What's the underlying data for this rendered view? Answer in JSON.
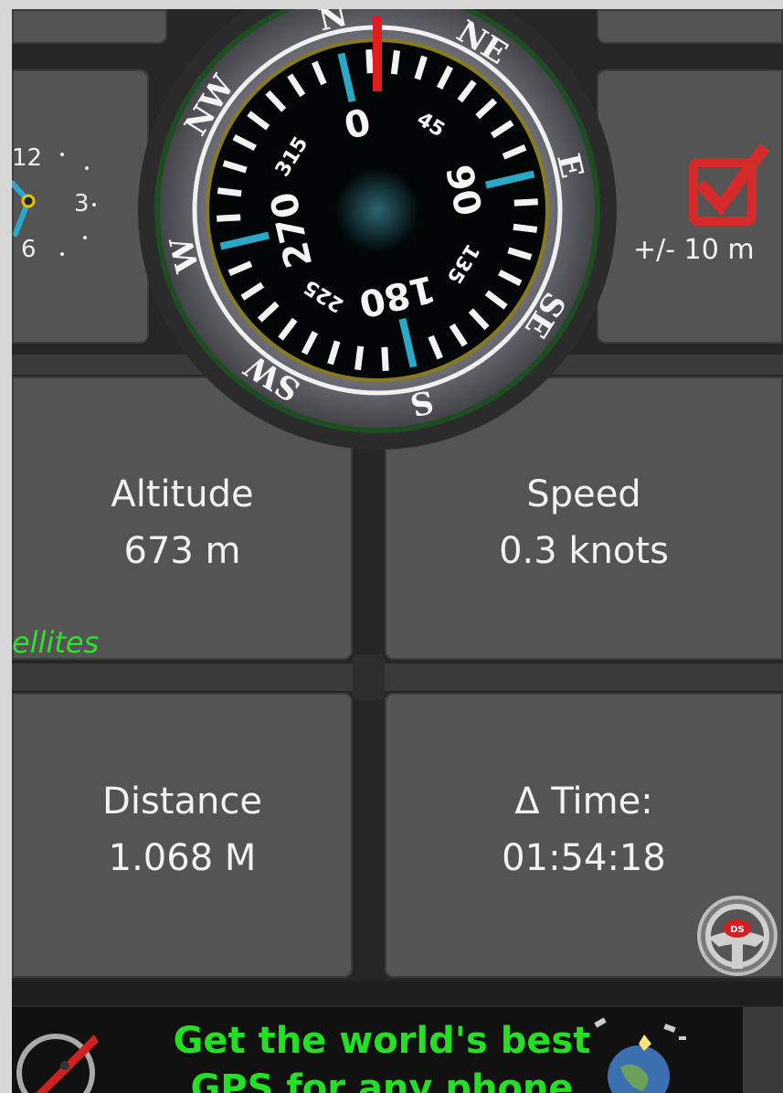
{
  "clock": {
    "numerals": [
      "12",
      "3",
      "6"
    ]
  },
  "compass": {
    "cardinals": [
      "N",
      "NE",
      "E",
      "SE",
      "S",
      "SW",
      "W",
      "NW"
    ],
    "degree_labels": [
      "0",
      "45",
      "90",
      "135",
      "180",
      "225",
      "270",
      "315"
    ]
  },
  "accuracy": {
    "value_text": "+/- 10 m",
    "checkbox_checked": true,
    "icon": "checkbox-checked-icon",
    "color": "#e02020"
  },
  "tiles": {
    "altitude": {
      "label": "Altitude",
      "value": "673 m"
    },
    "speed": {
      "label": "Speed",
      "value": "0.3 knots"
    },
    "distance": {
      "label": "Distance",
      "value": "1.068 M"
    },
    "delta_time": {
      "label": "Δ Time:",
      "value": "01:54:18"
    }
  },
  "satellites_text": "ellites",
  "steering_button": {
    "icon": "steering-wheel-icon",
    "badge": "DS"
  },
  "ad": {
    "line1": "Get the world's best",
    "line2": "GPS for any phone",
    "text_color": "#23e023",
    "left_icon": "compass-icon",
    "right_icon": "globe-satellite-icon"
  }
}
